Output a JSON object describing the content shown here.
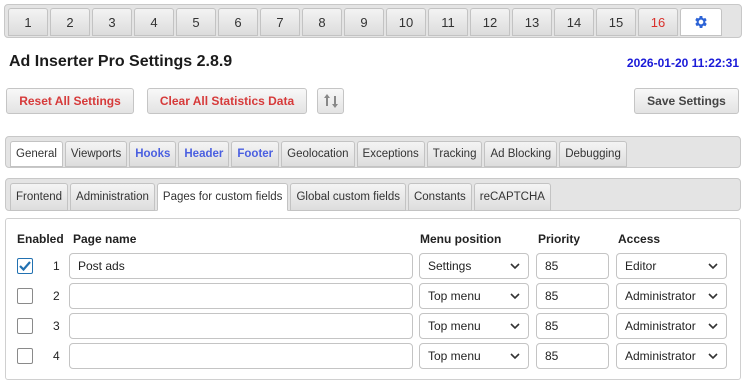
{
  "block_tabs": [
    "1",
    "2",
    "3",
    "4",
    "5",
    "6",
    "7",
    "8",
    "9",
    "10",
    "11",
    "12",
    "13",
    "14",
    "15",
    "16"
  ],
  "colors": {
    "accent_red": "#d63a3a",
    "link_blue": "#4a5fe0",
    "datetime_blue": "#1a1ad8",
    "checkbox_blue": "#2271b1"
  },
  "header": {
    "title": "Ad Inserter Pro Settings 2.8.9",
    "datetime": "2026-01-20 11:22:31"
  },
  "toolbar": {
    "reset_label": "Reset All Settings",
    "clear_label": "Clear All Statistics Data",
    "sort_icon": "up-down-arrows-icon",
    "save_label": "Save Settings"
  },
  "main_tabs": [
    "General",
    "Viewports",
    "Hooks",
    "Header",
    "Footer",
    "Geolocation",
    "Exceptions",
    "Tracking",
    "Ad Blocking",
    "Debugging"
  ],
  "sub_tabs": [
    "Frontend",
    "Administration",
    "Pages for custom fields",
    "Global custom fields",
    "Constants",
    "reCAPTCHA"
  ],
  "table": {
    "headers": {
      "enabled": "Enabled",
      "page_name": "Page name",
      "menu_position": "Menu position",
      "priority": "Priority",
      "access": "Access"
    },
    "rows": [
      {
        "index": "1",
        "checked": true,
        "page_name": "Post ads",
        "menu_position": "Settings",
        "priority": "85",
        "access": "Editor"
      },
      {
        "index": "2",
        "checked": false,
        "page_name": "",
        "menu_position": "Top menu",
        "priority": "85",
        "access": "Administrator"
      },
      {
        "index": "3",
        "checked": false,
        "page_name": "",
        "menu_position": "Top menu",
        "priority": "85",
        "access": "Administrator"
      },
      {
        "index": "4",
        "checked": false,
        "page_name": "",
        "menu_position": "Top menu",
        "priority": "85",
        "access": "Administrator"
      }
    ]
  }
}
